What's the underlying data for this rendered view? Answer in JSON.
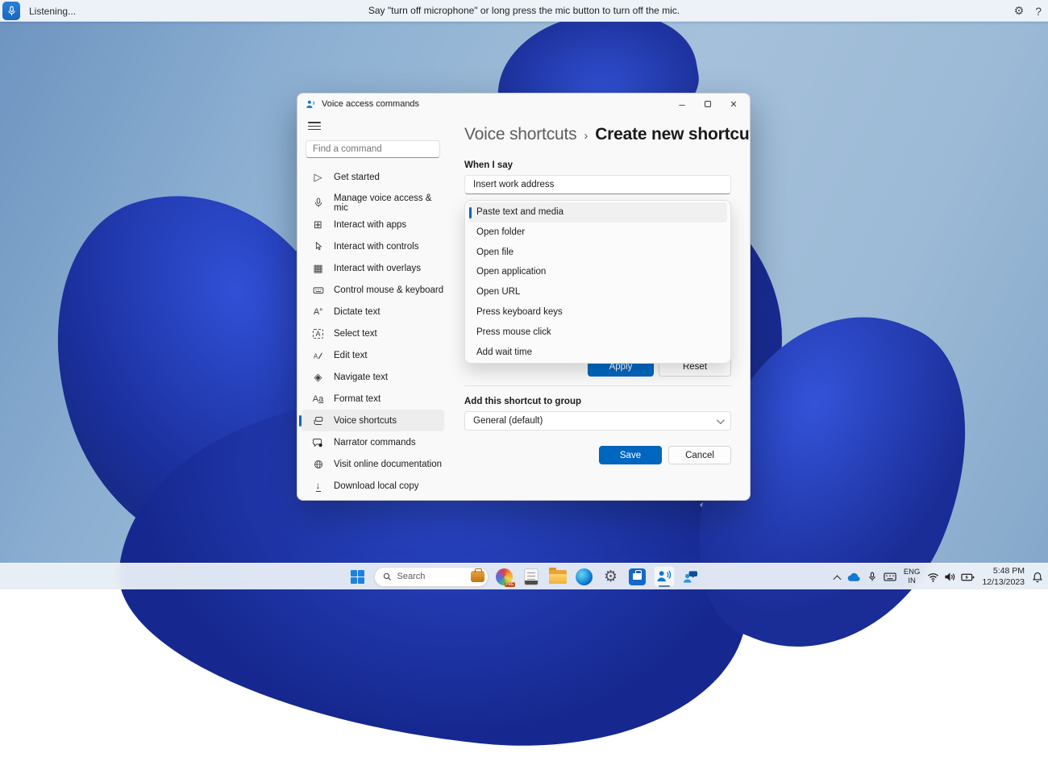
{
  "colors": {
    "accent": "#0067c0",
    "mic_button": "#1f6fd0",
    "taskbar_bg": "#eef3f9"
  },
  "voice_bar": {
    "status": "Listening...",
    "instruction": "Say \"turn off microphone\" or long press the mic button to turn off the mic.",
    "settings_glyph": "⚙",
    "help_glyph": "?"
  },
  "window": {
    "title": "Voice access commands",
    "controls": {
      "minimize": "–",
      "close": "✕"
    },
    "sidebar": {
      "search_placeholder": "Find a command",
      "items": [
        {
          "label": "Get started",
          "icon": "play-icon"
        },
        {
          "label": "Manage voice access & mic",
          "icon": "mic-icon"
        },
        {
          "label": "Interact with apps",
          "icon": "apps-grid-icon"
        },
        {
          "label": "Interact with controls",
          "icon": "cursor-icon"
        },
        {
          "label": "Interact with overlays",
          "icon": "overlay-grid-icon"
        },
        {
          "label": "Control mouse & keyboard",
          "icon": "keyboard-icon"
        },
        {
          "label": "Dictate text",
          "icon": "dictate-icon"
        },
        {
          "label": "Select text",
          "icon": "select-text-icon"
        },
        {
          "label": "Edit text",
          "icon": "edit-text-icon"
        },
        {
          "label": "Navigate text",
          "icon": "navigate-text-icon"
        },
        {
          "label": "Format text",
          "icon": "format-text-icon"
        },
        {
          "label": "Voice shortcuts",
          "icon": "voice-shortcuts-icon",
          "selected": true
        },
        {
          "label": "Narrator commands",
          "icon": "narrator-icon"
        }
      ],
      "footer_items": [
        {
          "label": "Visit online documentation",
          "icon": "globe-icon"
        },
        {
          "label": "Download local copy",
          "icon": "download-icon"
        }
      ]
    },
    "main": {
      "breadcrumb": {
        "parent": "Voice shortcuts",
        "separator": "›",
        "current": "Create new shortcut"
      },
      "when_i_say_label": "When I say",
      "shortcut_name_value": "Insert work address",
      "action_dropdown": {
        "selected_index": 0,
        "items": [
          "Paste text and media",
          "Open folder",
          "Open file",
          "Open application",
          "Open URL",
          "Press keyboard keys",
          "Press mouse click",
          "Add wait time"
        ]
      },
      "apply_label": "Apply",
      "reset_label": "Reset",
      "group_label": "Add this shortcut to group",
      "group_value": "General (default)",
      "save_label": "Save",
      "cancel_label": "Cancel"
    }
  },
  "taskbar": {
    "search_placeholder": "Search",
    "preview_badge": "PRE",
    "tray": {
      "language_line1": "ENG",
      "language_line2": "IN",
      "time": "5:48 PM",
      "date": "12/13/2023"
    }
  }
}
